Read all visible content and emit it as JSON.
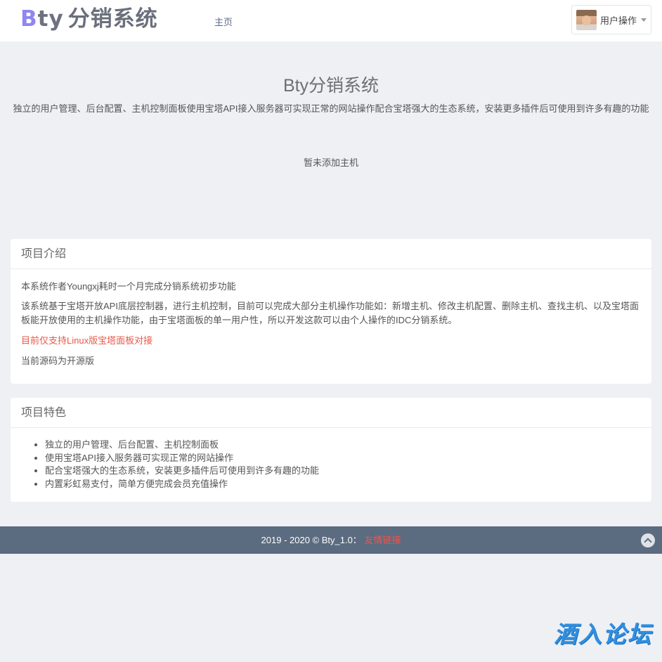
{
  "header": {
    "logo_b": "B",
    "logo_ty": "ty",
    "logo_cn": "分销系统",
    "nav_home": "主页",
    "user_menu_label": "用户操作"
  },
  "hero": {
    "title": "Bty分销系统",
    "description": "独立的用户管理、后台配置、主机控制面板使用宝塔API接入服务器可实现正常的网站操作配合宝塔强大的生态系统，安装更多插件后可使用到许多有趣的功能"
  },
  "hosts": {
    "empty_text": "暂未添加主机"
  },
  "intro": {
    "heading": "项目介绍",
    "paragraphs": [
      "本系统作者Youngxj耗时一个月完成分销系统初步功能",
      "该系统基于宝塔开放API底层控制器，进行主机控制，目前可以完成大部分主机操作功能如：新增主机、修改主机配置、删除主机、查找主机、以及宝塔面板能开放使用的主机操作功能，由于宝塔面板的单一用户性，所以开发这款可以由个人操作的IDC分销系统。",
      "目前仅支持Linux版宝塔面板对接",
      "当前源码为开源版"
    ]
  },
  "features": {
    "heading": "项目特色",
    "items": [
      "独立的用户管理、后台配置、主机控制面板",
      "使用宝塔API接入服务器可实现正常的网站操作",
      "配合宝塔强大的生态系统，安装更多插件后可使用到许多有趣的功能",
      "内置彩虹易支付，简单方便完成会员充值操作"
    ]
  },
  "footer": {
    "copyright": "2019 - 2020 © Bty_1.0：",
    "friend_link": "友情链接"
  },
  "watermark": "酒入论坛",
  "colors": {
    "background": "#eff0f4",
    "footer": "#5b6b80",
    "accent_red": "#e8584a",
    "logo_b": "#8f86f0"
  }
}
